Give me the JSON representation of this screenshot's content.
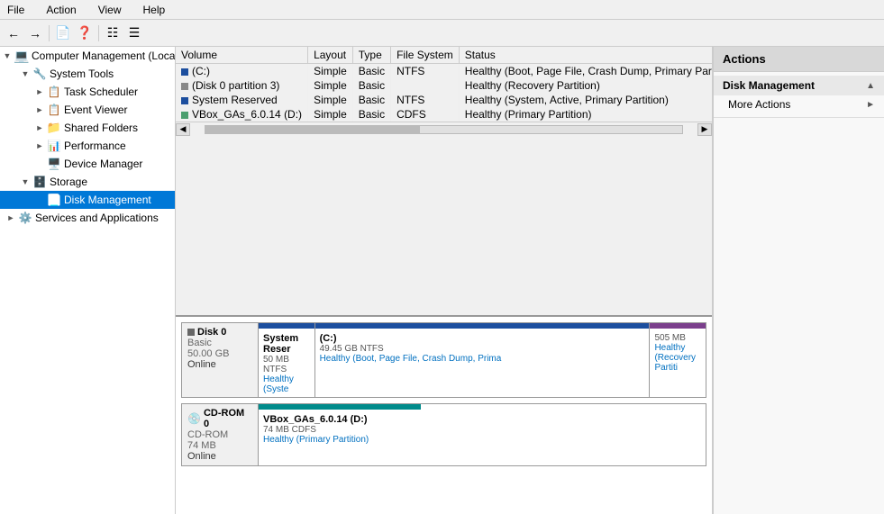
{
  "menubar": {
    "items": [
      "File",
      "Action",
      "View",
      "Help"
    ]
  },
  "toolbar": {
    "back_tooltip": "Back",
    "forward_tooltip": "Forward",
    "up_tooltip": "Up",
    "refresh_tooltip": "Refresh"
  },
  "tree": {
    "root_label": "Computer Management (Local",
    "items": [
      {
        "id": "system-tools",
        "label": "System Tools",
        "level": 1,
        "expanded": true,
        "icon": "tools"
      },
      {
        "id": "task-scheduler",
        "label": "Task Scheduler",
        "level": 2,
        "expanded": false,
        "icon": "task"
      },
      {
        "id": "event-viewer",
        "label": "Event Viewer",
        "level": 2,
        "expanded": false,
        "icon": "event"
      },
      {
        "id": "shared-folders",
        "label": "Shared Folders",
        "level": 2,
        "expanded": false,
        "icon": "folder"
      },
      {
        "id": "performance",
        "label": "Performance",
        "level": 2,
        "expanded": false,
        "icon": "perf"
      },
      {
        "id": "device-manager",
        "label": "Device Manager",
        "level": 2,
        "expanded": false,
        "icon": "device"
      },
      {
        "id": "storage",
        "label": "Storage",
        "level": 1,
        "expanded": true,
        "icon": "storage"
      },
      {
        "id": "disk-management",
        "label": "Disk Management",
        "level": 2,
        "expanded": false,
        "icon": "disk",
        "selected": true
      },
      {
        "id": "services",
        "label": "Services and Applications",
        "level": 1,
        "expanded": false,
        "icon": "services"
      }
    ]
  },
  "table": {
    "columns": [
      "Volume",
      "Layout",
      "Type",
      "File System",
      "Status"
    ],
    "rows": [
      {
        "volume": "(C:)",
        "layout": "Simple",
        "type": "Basic",
        "filesystem": "NTFS",
        "status": "Healthy (Boot, Page File, Crash Dump, Primary Partition)",
        "icon": "blue"
      },
      {
        "volume": "(Disk 0 partition 3)",
        "layout": "Simple",
        "type": "Basic",
        "filesystem": "",
        "status": "Healthy (Recovery Partition)",
        "icon": "gray"
      },
      {
        "volume": "System Reserved",
        "layout": "Simple",
        "type": "Basic",
        "filesystem": "NTFS",
        "status": "Healthy (System, Active, Primary Partition)",
        "icon": "blue"
      },
      {
        "volume": "VBox_GAs_6.0.14 (D:)",
        "layout": "Simple",
        "type": "Basic",
        "filesystem": "CDFS",
        "status": "Healthy (Primary Partition)",
        "icon": "cdrom"
      }
    ]
  },
  "disks": [
    {
      "id": "disk0",
      "name": "Disk 0",
      "type": "Basic",
      "size": "50.00 GB",
      "status": "Online",
      "partitions": [
        {
          "name": "System Reser",
          "detail": "50 MB NTFS",
          "status": "Healthy (Syste",
          "color": "blue",
          "flex": 1
        },
        {
          "name": "(C:)",
          "detail": "49.45 GB NTFS",
          "status": "Healthy (Boot, Page File, Crash Dump, Prima",
          "color": "blue",
          "flex": 7
        },
        {
          "name": "",
          "detail": "505 MB",
          "status": "Healthy (Recovery Partiti",
          "color": "purple",
          "flex": 1
        }
      ]
    },
    {
      "id": "cdrom0",
      "name": "CD-ROM 0",
      "type": "CD-ROM",
      "size": "74 MB",
      "status": "Online",
      "partitions": [
        {
          "name": "VBox_GAs_6.0.14 (D:)",
          "detail": "74 MB CDFS",
          "status": "Healthy (Primary Partition)",
          "color": "cyan",
          "flex": 1
        }
      ]
    }
  ],
  "actions": {
    "header": "Actions",
    "sections": [
      {
        "title": "Disk Management",
        "items": [
          "More Actions"
        ],
        "has_submenu": [
          true
        ]
      }
    ]
  }
}
